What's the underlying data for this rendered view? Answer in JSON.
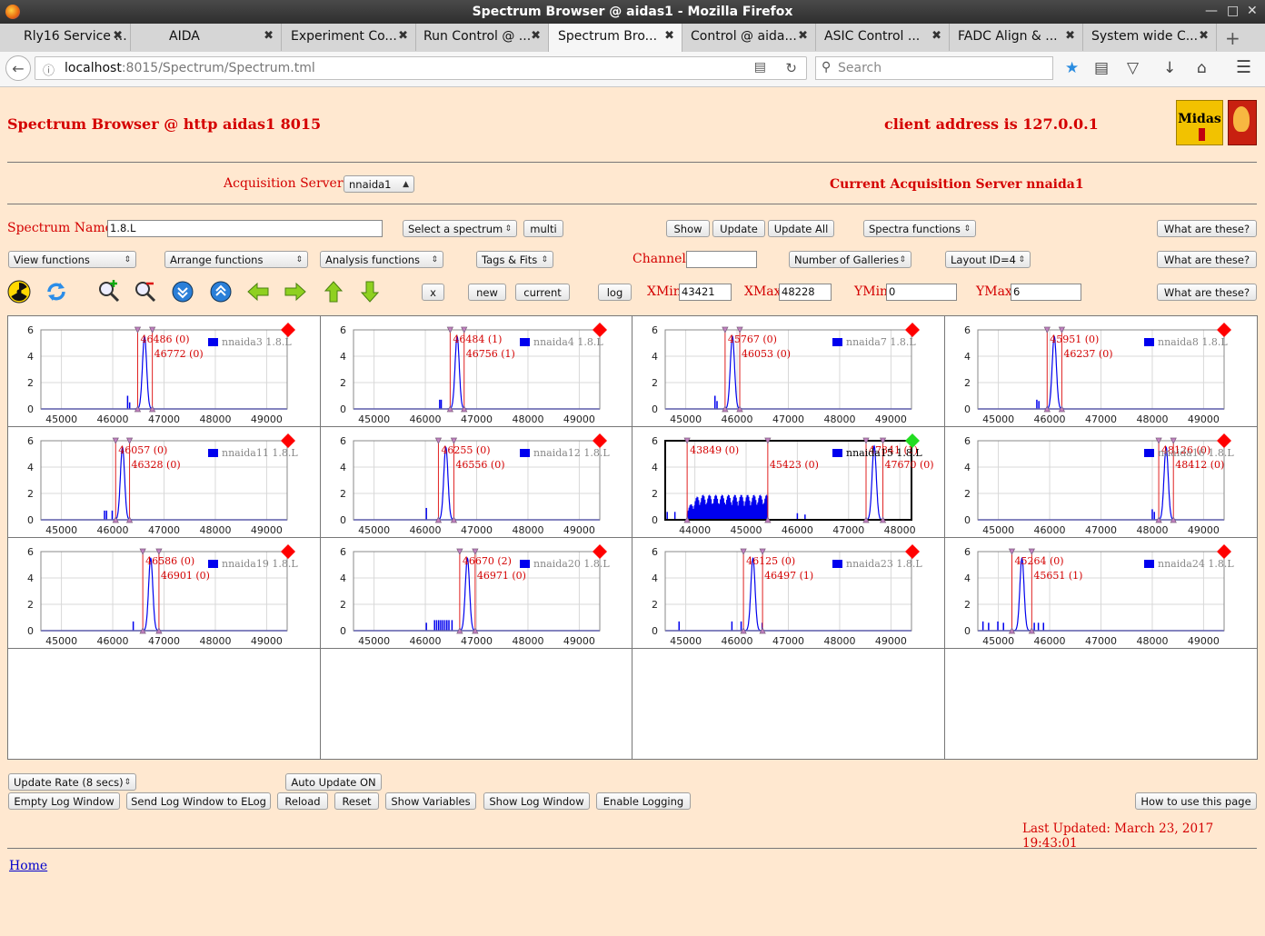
{
  "window": {
    "title": "Spectrum Browser @ aidas1 - Mozilla Firefox"
  },
  "tabs": [
    {
      "label": "Rly16 Service ..."
    },
    {
      "label": "AIDA"
    },
    {
      "label": "Experiment Co..."
    },
    {
      "label": "Run Control @ ..."
    },
    {
      "label": "Spectrum Bro...",
      "active": true
    },
    {
      "label": "Control @ aida..."
    },
    {
      "label": "ASIC Control ..."
    },
    {
      "label": "FADC Align & ..."
    },
    {
      "label": "System wide C..."
    }
  ],
  "nav": {
    "url_host": "localhost",
    "url_rest": ":8015/Spectrum/Spectrum.tml",
    "search_placeholder": "Search"
  },
  "page": {
    "heading": "Spectrum Browser @ http aidas1 8015",
    "client": "client address is 127.0.0.1",
    "logo_text": "Midas",
    "acq_label": "Acquisition Servers",
    "acq_value": "nnaida1",
    "current_server": "Current Acquisition Server nnaida1",
    "spectrum_label": "Spectrum Name:",
    "spectrum_value": "1.8.L",
    "select_spectrum": "Select a spectrum",
    "multi": "multi",
    "show": "Show",
    "update": "Update",
    "update_all": "Update All",
    "spectra_functions": "Spectra functions",
    "what": "What are these?",
    "view_functions": "View functions",
    "arrange_functions": "Arrange functions",
    "analysis_functions": "Analysis functions",
    "tags_fits": "Tags & Fits",
    "channel_label": "Channel:",
    "channel_value": "",
    "galleries": "Number of Galleries",
    "layout": "Layout ID=4",
    "x_btn": "x",
    "new_btn": "new",
    "current_btn": "current",
    "log_btn": "log",
    "xmin_label": "XMin",
    "xmin": "43421",
    "xmax_label": "XMax",
    "xmax": "48228",
    "ymin_label": "YMin",
    "ymin": "0",
    "ymax_label": "YMax",
    "ymax": "6",
    "update_rate": "Update Rate (8 secs)",
    "auto_update": "Auto Update ON",
    "empty_log": "Empty Log Window",
    "send_log": "Send Log Window to ELog",
    "reload": "Reload",
    "reset": "Reset",
    "show_vars": "Show Variables",
    "show_log": "Show Log Window",
    "enable_logging": "Enable Logging",
    "howto": "How to use this page",
    "last_updated": "Last Updated: March 23, 2017 19:43:01",
    "home": "Home"
  },
  "toolbar_icons": [
    "radiation-icon",
    "refresh-icon",
    "zoom-in-icon",
    "zoom-out-icon",
    "scroll-down-icon",
    "scroll-up-icon",
    "arrow-left-icon",
    "arrow-right-icon",
    "arrow-up-icon",
    "arrow-down-icon"
  ],
  "colors": {
    "accent_red": "#d40000",
    "series_blue": "#0000ee",
    "status_red": "#ff0000",
    "status_green": "#22dd22",
    "page_bg": "#ffe8d0"
  },
  "chart_data": [
    {
      "type": "line",
      "series": [
        {
          "name": "nnaida3 1.8.L"
        }
      ],
      "x_ticks": [
        45000,
        46000,
        47000,
        48000,
        49000
      ],
      "y_ticks": [
        0,
        2,
        4,
        6
      ],
      "xlim": [
        44600,
        49400
      ],
      "ylim": [
        0,
        6
      ],
      "peaks": [
        {
          "center": 46620,
          "height": 5.5
        }
      ],
      "noise": [
        {
          "x": 46290,
          "h": 1.0
        },
        {
          "x": 46330,
          "h": 0.5
        }
      ],
      "markers": [
        {
          "x": 46486,
          "label": "46486 (0)"
        },
        {
          "x": 46772,
          "label": "46772 (0)"
        }
      ],
      "status": "red"
    },
    {
      "type": "line",
      "series": [
        {
          "name": "nnaida4 1.8.L"
        }
      ],
      "x_ticks": [
        45000,
        46000,
        47000,
        48000,
        49000
      ],
      "y_ticks": [
        0,
        2,
        4,
        6
      ],
      "xlim": [
        44600,
        49400
      ],
      "ylim": [
        0,
        6
      ],
      "peaks": [
        {
          "center": 46620,
          "height": 5.5
        }
      ],
      "noise": [
        {
          "x": 46280,
          "h": 0.7
        },
        {
          "x": 46310,
          "h": 0.7
        }
      ],
      "markers": [
        {
          "x": 46484,
          "label": "46484 (1)"
        },
        {
          "x": 46756,
          "label": "46756 (1)"
        }
      ],
      "status": "red"
    },
    {
      "type": "line",
      "series": [
        {
          "name": "nnaida7 1.8.L"
        }
      ],
      "x_ticks": [
        45000,
        46000,
        47000,
        48000,
        49000
      ],
      "y_ticks": [
        0,
        2,
        4,
        6
      ],
      "xlim": [
        44600,
        49400
      ],
      "ylim": [
        0,
        6
      ],
      "peaks": [
        {
          "center": 45910,
          "height": 5.5
        }
      ],
      "noise": [
        {
          "x": 45570,
          "h": 1.0
        },
        {
          "x": 45610,
          "h": 0.6
        }
      ],
      "markers": [
        {
          "x": 45767,
          "label": "45767 (0)"
        },
        {
          "x": 46053,
          "label": "46053 (0)"
        }
      ],
      "status": "red"
    },
    {
      "type": "line",
      "series": [
        {
          "name": "nnaida8 1.8.L"
        }
      ],
      "x_ticks": [
        45000,
        46000,
        47000,
        48000,
        49000
      ],
      "y_ticks": [
        0,
        2,
        4,
        6
      ],
      "xlim": [
        44600,
        49400
      ],
      "ylim": [
        0,
        6
      ],
      "peaks": [
        {
          "center": 46090,
          "height": 5.5
        }
      ],
      "noise": [
        {
          "x": 45750,
          "h": 0.7
        },
        {
          "x": 45790,
          "h": 0.6
        }
      ],
      "markers": [
        {
          "x": 45951,
          "label": "45951 (0)"
        },
        {
          "x": 46237,
          "label": "46237 (0)"
        }
      ],
      "status": "red"
    },
    {
      "type": "line",
      "series": [
        {
          "name": "nnaida11 1.8.L"
        }
      ],
      "x_ticks": [
        45000,
        46000,
        47000,
        48000,
        49000
      ],
      "y_ticks": [
        0,
        2,
        4,
        6
      ],
      "xlim": [
        44600,
        49400
      ],
      "ylim": [
        0,
        6
      ],
      "peaks": [
        {
          "center": 46190,
          "height": 5.5
        }
      ],
      "noise": [
        {
          "x": 45840,
          "h": 0.7
        },
        {
          "x": 45880,
          "h": 0.7
        },
        {
          "x": 45990,
          "h": 0.7
        }
      ],
      "markers": [
        {
          "x": 46057,
          "label": "46057 (0)"
        },
        {
          "x": 46328,
          "label": "46328 (0)"
        }
      ],
      "status": "red"
    },
    {
      "type": "line",
      "series": [
        {
          "name": "nnaida12 1.8.L"
        }
      ],
      "x_ticks": [
        45000,
        46000,
        47000,
        48000,
        49000
      ],
      "y_ticks": [
        0,
        2,
        4,
        6
      ],
      "xlim": [
        44600,
        49400
      ],
      "ylim": [
        0,
        6
      ],
      "peaks": [
        {
          "center": 46400,
          "height": 5.5
        }
      ],
      "noise": [
        {
          "x": 46020,
          "h": 0.9
        }
      ],
      "markers": [
        {
          "x": 46255,
          "label": "46255 (0)"
        },
        {
          "x": 46556,
          "label": "46556 (0)"
        }
      ],
      "status": "red"
    },
    {
      "type": "line",
      "series": [
        {
          "name": "nnaida15 1.8.L"
        }
      ],
      "x_ticks": [
        44000,
        45000,
        46000,
        47000,
        48000
      ],
      "y_ticks": [
        0,
        2,
        4,
        6
      ],
      "xlim": [
        43421,
        48228
      ],
      "ylim": [
        0,
        6
      ],
      "peaks": [
        {
          "center": 47500,
          "height": 5.6
        }
      ],
      "band": [
        43850,
        45420,
        1.9
      ],
      "noise": [
        {
          "x": 43460,
          "h": 0.6
        },
        {
          "x": 43610,
          "h": 0.6
        },
        {
          "x": 46000,
          "h": 0.5
        },
        {
          "x": 46150,
          "h": 0.4
        }
      ],
      "markers": [
        {
          "x": 43849,
          "label": "43849 (0)"
        },
        {
          "x": 45423,
          "label": "45423 (0)"
        },
        {
          "x": 47341,
          "label": "47341 (1)"
        },
        {
          "x": 47670,
          "label": "47670 (0)"
        }
      ],
      "status": "green",
      "selected": true
    },
    {
      "type": "line",
      "series": [
        {
          "name": "nnaida16 1.8.L"
        }
      ],
      "x_ticks": [
        45000,
        46000,
        47000,
        48000,
        49000
      ],
      "y_ticks": [
        0,
        2,
        4,
        6
      ],
      "xlim": [
        44600,
        49400
      ],
      "ylim": [
        0,
        6
      ],
      "peaks": [
        {
          "center": 48270,
          "height": 5.5
        }
      ],
      "noise": [
        {
          "x": 48000,
          "h": 0.8
        },
        {
          "x": 48040,
          "h": 0.6
        }
      ],
      "markers": [
        {
          "x": 48126,
          "label": "48126 (0)"
        },
        {
          "x": 48412,
          "label": "48412 (0)"
        }
      ],
      "status": "red"
    },
    {
      "type": "line",
      "series": [
        {
          "name": "nnaida19 1.8.L"
        }
      ],
      "x_ticks": [
        45000,
        46000,
        47000,
        48000,
        49000
      ],
      "y_ticks": [
        0,
        2,
        4,
        6
      ],
      "xlim": [
        44600,
        49400
      ],
      "ylim": [
        0,
        6
      ],
      "peaks": [
        {
          "center": 46740,
          "height": 5.5
        }
      ],
      "noise": [
        {
          "x": 46400,
          "h": 0.7
        }
      ],
      "markers": [
        {
          "x": 46586,
          "label": "46586 (0)"
        },
        {
          "x": 46901,
          "label": "46901 (0)"
        }
      ],
      "status": "red"
    },
    {
      "type": "line",
      "series": [
        {
          "name": "nnaida20 1.8.L"
        }
      ],
      "x_ticks": [
        45000,
        46000,
        47000,
        48000,
        49000
      ],
      "y_ticks": [
        0,
        2,
        4,
        6
      ],
      "xlim": [
        44600,
        49400
      ],
      "ylim": [
        0,
        6
      ],
      "peaks": [
        {
          "center": 46820,
          "height": 5.5
        }
      ],
      "noise": [
        {
          "x": 46020,
          "h": 0.6
        },
        {
          "x": 46180,
          "h": 0.8
        },
        {
          "x": 46220,
          "h": 0.8
        },
        {
          "x": 46260,
          "h": 0.8
        },
        {
          "x": 46300,
          "h": 0.8
        },
        {
          "x": 46340,
          "h": 0.8
        },
        {
          "x": 46380,
          "h": 0.8
        },
        {
          "x": 46420,
          "h": 0.8
        },
        {
          "x": 46460,
          "h": 0.8
        },
        {
          "x": 46520,
          "h": 0.8
        }
      ],
      "markers": [
        {
          "x": 46670,
          "label": "46670 (2)"
        },
        {
          "x": 46971,
          "label": "46971 (0)"
        }
      ],
      "status": "red"
    },
    {
      "type": "line",
      "series": [
        {
          "name": "nnaida23 1.8.L"
        }
      ],
      "x_ticks": [
        45000,
        46000,
        47000,
        48000,
        49000
      ],
      "y_ticks": [
        0,
        2,
        4,
        6
      ],
      "xlim": [
        44600,
        49400
      ],
      "ylim": [
        0,
        6
      ],
      "peaks": [
        {
          "center": 46310,
          "height": 5.5
        }
      ],
      "noise": [
        {
          "x": 44870,
          "h": 0.7
        },
        {
          "x": 45900,
          "h": 0.7
        },
        {
          "x": 46080,
          "h": 0.7
        },
        {
          "x": 46490,
          "h": 0.6
        }
      ],
      "markers": [
        {
          "x": 46125,
          "label": "46125 (0)"
        },
        {
          "x": 46497,
          "label": "46497 (1)"
        }
      ],
      "status": "red"
    },
    {
      "type": "line",
      "series": [
        {
          "name": "nnaida24 1.8.L"
        }
      ],
      "x_ticks": [
        45000,
        46000,
        47000,
        48000,
        49000
      ],
      "y_ticks": [
        0,
        2,
        4,
        6
      ],
      "xlim": [
        44600,
        49400
      ],
      "ylim": [
        0,
        6
      ],
      "peaks": [
        {
          "center": 45460,
          "height": 5.5
        }
      ],
      "noise": [
        {
          "x": 44700,
          "h": 0.7
        },
        {
          "x": 44810,
          "h": 0.6
        },
        {
          "x": 44990,
          "h": 0.7
        },
        {
          "x": 45100,
          "h": 0.6
        },
        {
          "x": 45700,
          "h": 0.6
        },
        {
          "x": 45780,
          "h": 0.6
        },
        {
          "x": 45880,
          "h": 0.6
        }
      ],
      "markers": [
        {
          "x": 45264,
          "label": "45264 (0)"
        },
        {
          "x": 45651,
          "label": "45651 (1)"
        }
      ],
      "status": "red"
    }
  ]
}
